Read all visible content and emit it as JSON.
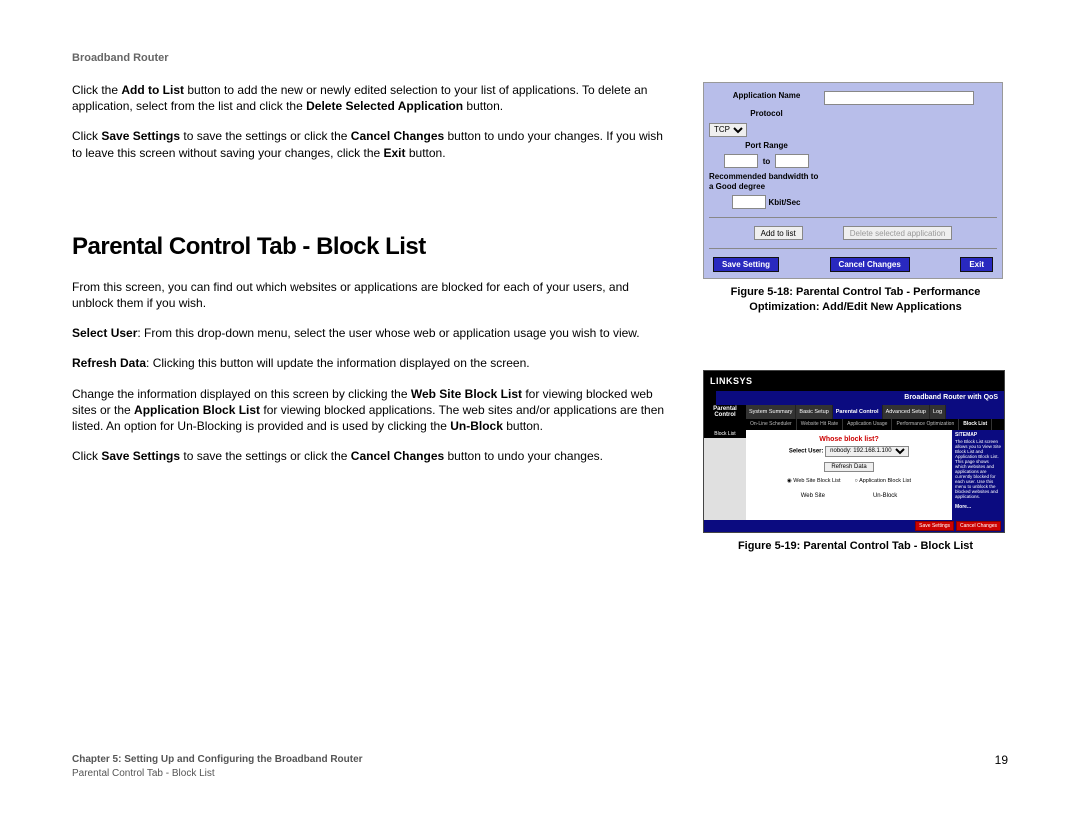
{
  "header": "Broadband Router",
  "para1_a": "Click the ",
  "para1_b": "Add to List",
  "para1_c": " button to add the new or newly edited selection to your list of applications. To delete an application, select from the list and click the ",
  "para1_d": "Delete Selected Application",
  "para1_e": " button.",
  "para2_a": "Click ",
  "para2_b": "Save Settings",
  "para2_c": " to save the settings or click the ",
  "para2_d": "Cancel Changes",
  "para2_e": " button to undo your changes. If you wish to leave this screen without saving your changes, click the ",
  "para2_f": "Exit",
  "para2_g": " button.",
  "heading": "Parental Control Tab - Block List",
  "para3": "From this screen, you can find out which websites or applications are blocked for each of your users, and unblock them if you wish.",
  "para4_a": "Select User",
  "para4_b": ": From this drop-down menu, select the user whose web or application usage you wish to view.",
  "para5_a": "Refresh Data",
  "para5_b": ": Clicking this button will update the information displayed on the screen.",
  "para6_a": "Change the information displayed on this screen by clicking the ",
  "para6_b": "Web Site Block List",
  "para6_c": " for viewing blocked web sites or the ",
  "para6_d": "Application Block List",
  "para6_e": " for viewing blocked applications. The web sites and/or applications are then listed. An option for Un-Blocking is provided and is used by clicking the ",
  "para6_f": "Un-Block",
  "para6_g": " button.",
  "para7_a": "Click ",
  "para7_b": "Save Settings",
  "para7_c": " to save the settings or click the ",
  "para7_d": "Cancel Changes",
  "para7_e": " button to undo your changes.",
  "fig18": {
    "app_name_label": "Application Name",
    "protocol_label": "Protocol",
    "protocol_value": "TCP",
    "port_range_label": "Port Range",
    "port_to": "to",
    "bw_label": "Recommended bandwidth to a Good degree",
    "bw_unit": "Kbit/Sec",
    "add_btn": "Add to list",
    "delete_btn": "Delete selected application",
    "save_btn": "Save Setting",
    "cancel_btn": "Cancel Changes",
    "exit_btn": "Exit",
    "caption_a": "Figure 5-18: Parental Control Tab - Performance",
    "caption_b": "Optimization: Add/Edit New Applications"
  },
  "fig19": {
    "brand": "LINKSYS",
    "product": "Broadband Router with QoS",
    "section": "Parental Control",
    "nav": {
      "a": "System Summary",
      "b": "Basic Setup",
      "c": "Parental Control",
      "d": "Advanced Setup",
      "e": "Log"
    },
    "subnav": {
      "a": "On-Line Scheduler",
      "b": "Website Hit Rate",
      "c": "Application Usage",
      "d": "Performance Optimization",
      "e": "Block List"
    },
    "side_label": "Block List",
    "whose": "Whose block list?",
    "select_label": "Select User:",
    "select_value": "nobody: 192.168.1.100",
    "refresh": "Refresh Data",
    "radio_a": "Web Site Block List",
    "radio_b": "Application Block List",
    "data_a": "Web Site",
    "data_b": "Un-Block",
    "help_title": "SITEMAP",
    "help_body": "The Block List screen allows you to View Site Block List and Application Block List. This page shows which websites and applications are currently blocked for each user. Use this menu to unblock the blocked websites and applications.",
    "help_more": "More...",
    "save": "Save Settings",
    "cancel": "Cancel Changes",
    "caption": "Figure 5-19: Parental Control Tab - Block List"
  },
  "footer": {
    "chapter": "Chapter 5: Setting Up and Configuring the Broadband Router",
    "section": "Parental Control Tab - Block List",
    "page": "19"
  }
}
